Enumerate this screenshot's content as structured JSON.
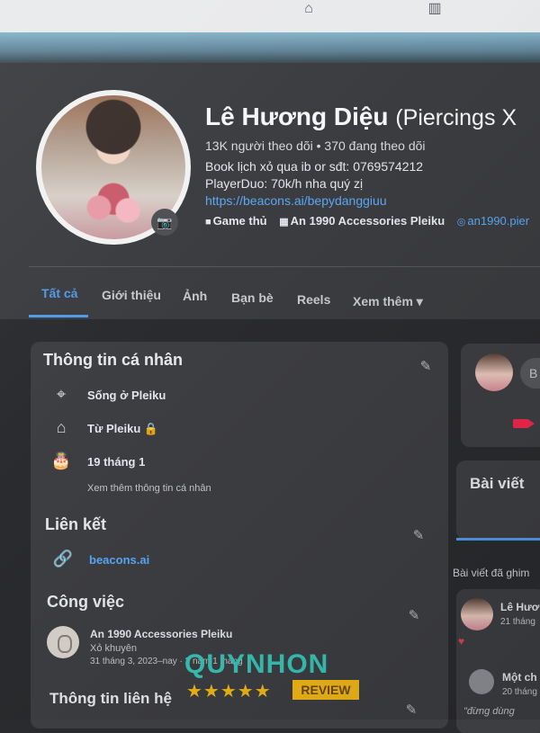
{
  "profile": {
    "name": "Lê Hương Diệu",
    "name_alt": "(Piercings X",
    "followers_line": "13K người theo dõi • 370 đang theo dõi",
    "bio_line1": "Book lịch xỏ qua ib or sđt: 0769574212",
    "bio_line2": "PlayerDuo: 70k/h nha quý zị",
    "bio_link": "https://beacons.ai/bepydanggiuu",
    "tags": [
      {
        "icon": "gamepad-icon",
        "label": "Game thủ"
      },
      {
        "icon": "building-icon",
        "label": "An 1990 Accessories Pleiku"
      },
      {
        "icon": "instagram-icon",
        "label": "an1990.pier"
      }
    ]
  },
  "tabs": [
    {
      "label": "Tất cả",
      "active": true
    },
    {
      "label": "Giới thiệu",
      "active": false
    },
    {
      "label": "Ảnh",
      "active": false
    },
    {
      "label": "Bạn bè",
      "active": false
    },
    {
      "label": "Reels",
      "active": false
    },
    {
      "label": "Xem thêm ▾",
      "active": false
    }
  ],
  "intro": {
    "title": "Thông tin cá nhân",
    "lives_in": "Sống ở Pleiku",
    "from": "Từ Pleiku 🔒",
    "birthday": "19 tháng 1",
    "see_more": "Xem thêm thông tin cá nhân"
  },
  "links": {
    "title": "Liên kết",
    "url": "beacons.ai"
  },
  "work": {
    "title": "Công việc",
    "company": "An 1990 Accessories Pleiku",
    "role": "Xỏ khuyên",
    "dates": "31 tháng 3, 2023–nay · 2 năm 1 tháng"
  },
  "contact": {
    "title": "Thông tin liên hệ"
  },
  "right": {
    "create_post_text": "B",
    "posts_title": "Bài viết",
    "pinned_label": "Bài viết đã ghim",
    "post_author": "Lê Hươ",
    "post_time": "21 tháng",
    "comment_author": "Một ch",
    "comment_time": "20 tháng",
    "comment_text": "\"đừng dùng"
  },
  "watermark": {
    "brand": "QUYNHON",
    "stars": "★★★★★",
    "review": "REVIEW"
  },
  "colors": {
    "accent": "#4f9ae8",
    "background": "#2a2b2e",
    "card": "#3d3e42",
    "watermark_teal": "#38c4b7",
    "watermark_gold": "#f2b818"
  }
}
